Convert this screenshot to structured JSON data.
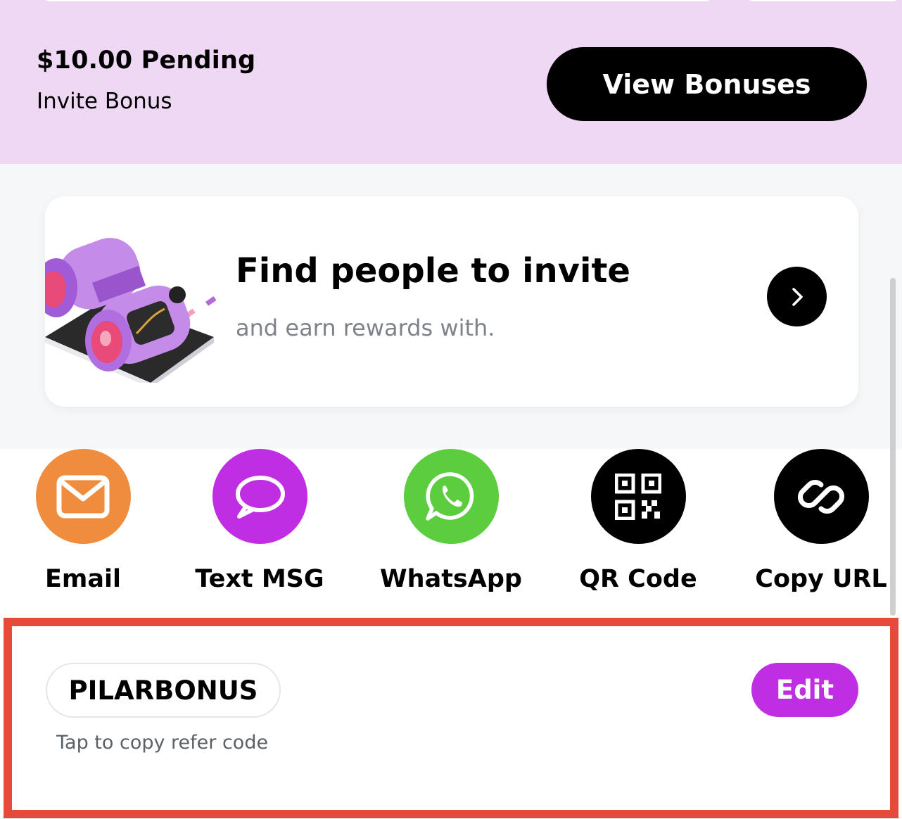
{
  "bonus": {
    "amount": "$10.00 Pending",
    "label": "Invite Bonus",
    "view_button": "View Bonuses"
  },
  "invite_card": {
    "title": "Find people to invite",
    "subtitle": "and earn rewards with.",
    "illustration": "binoculars-on-book",
    "arrow_icon": "chevron-right-icon"
  },
  "share_options": [
    {
      "label": "Email",
      "icon": "envelope-icon",
      "color": "#ef8c3d"
    },
    {
      "label": "Text MSG",
      "icon": "speech-bubble-icon",
      "color": "#c02ee3"
    },
    {
      "label": "WhatsApp",
      "icon": "whatsapp-icon",
      "color": "#5ccd3f"
    },
    {
      "label": "QR Code",
      "icon": "qr-code-icon",
      "color": "#000000"
    },
    {
      "label": "Copy URL",
      "icon": "link-icon",
      "color": "#000000"
    }
  ],
  "refer_code": {
    "code": "PILARBONUS",
    "hint": "Tap to copy refer code",
    "edit_button": "Edit"
  },
  "colors": {
    "header_bg": "#efd8f3",
    "accent_purple": "#c02ee3",
    "highlight_border": "#e64a3b"
  }
}
